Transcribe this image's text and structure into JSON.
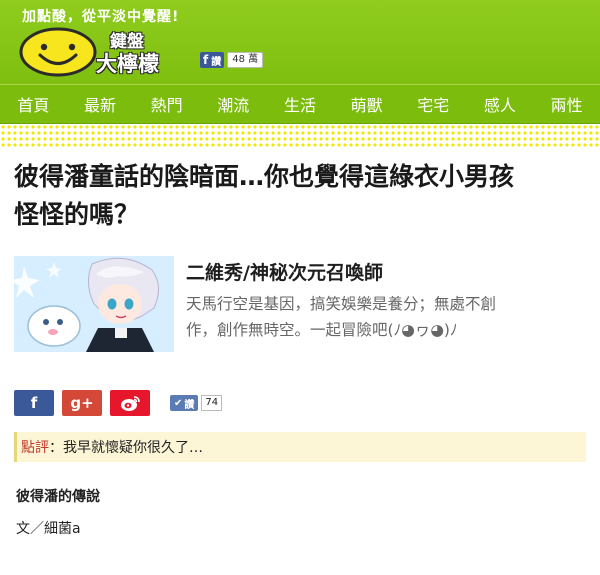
{
  "header": {
    "tagline": "加點酸，從平淡中覺醒!",
    "brand_line1": "鍵盤",
    "brand_line2": "大檸檬",
    "fb_like_label": "讚",
    "fb_like_count": "48 萬"
  },
  "nav": {
    "items": [
      "首頁",
      "最新",
      "熱門",
      "潮流",
      "生活",
      "萌獸",
      "宅宅",
      "感人",
      "兩性"
    ]
  },
  "article": {
    "title_line1": "彼得潘童話的陰暗面…你也覺得這綠衣小男孩",
    "title_line2": "怪怪的嗎？",
    "author_name": "二維秀/神秘次元召喚師",
    "author_desc_line1": "天馬行空是基因，搞笑娛樂是養分；無處不創",
    "author_desc_line2": "作，創作無時空。一起冒險吧(ﾉ◕ヮ◕)ﾉ",
    "share": {
      "fb_icon": "f",
      "gplus_icon": "g+",
      "like_label": "讚",
      "like_count": "74"
    },
    "comment_label": "點評",
    "comment_text": "：我早就懷疑你很久了…",
    "section_title": "彼得潘的傳說",
    "byline": "文／細菌a"
  },
  "colors": {
    "header_green": "#8fcc1d",
    "nav_green": "#7cbc0c",
    "dot_yellow": "#f2e800",
    "facebook_blue": "#3b5998",
    "gplus_red": "#d34836",
    "weibo_red": "#e6162d"
  }
}
